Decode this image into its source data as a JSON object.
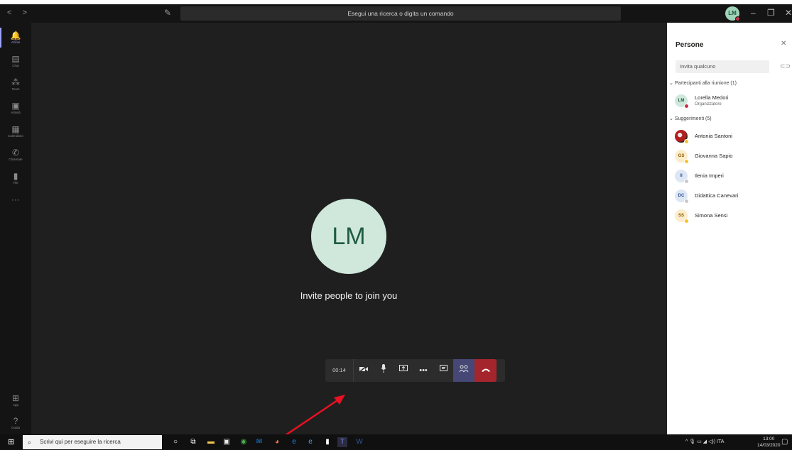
{
  "titlebar": {
    "nav_back": "<",
    "nav_forward": ">",
    "search_placeholder": "Esegui una ricerca o digita un comando",
    "user_initials": "LM",
    "minimize": "–",
    "maximize": "❐",
    "close": "✕"
  },
  "rail": {
    "items": [
      {
        "label": "Azioni",
        "icon": "bell-icon",
        "glyph": "🔔"
      },
      {
        "label": "Chat",
        "icon": "chat-icon",
        "glyph": "▤"
      },
      {
        "label": "Team",
        "icon": "team-icon",
        "glyph": "⁂"
      },
      {
        "label": "Attività",
        "icon": "assignments-icon",
        "glyph": "▣"
      },
      {
        "label": "Calendario",
        "icon": "calendar-icon",
        "glyph": "▦"
      },
      {
        "label": "Chiamate",
        "icon": "phone-icon",
        "glyph": "✆"
      },
      {
        "label": "File",
        "icon": "file-icon",
        "glyph": "▮"
      }
    ],
    "more": "···",
    "apps_label": "App",
    "help_label": "Guida"
  },
  "meeting": {
    "avatar_initials": "LM",
    "invite_text": "Invite people to join you",
    "timer": "00:14"
  },
  "panel": {
    "title": "Persone",
    "invite_placeholder": "Invita qualcuno",
    "participants_header": "Partecipanti alla riunione (1)",
    "participants": [
      {
        "initials": "LM",
        "name": "Lorella Medori",
        "role": "Organizzatore",
        "status_color": "#c4314b",
        "bg": "#d0e8dc",
        "fg": "#1f5c40"
      }
    ],
    "suggestions_header": "Suggerimenti (5)",
    "suggestions": [
      {
        "initials": "",
        "name": "Antonia Santoni",
        "status_color": "#f8c12c",
        "bg": "#5b3a2e",
        "fg": "#fff"
      },
      {
        "initials": "GS",
        "name": "Giovanna Sapio",
        "status_color": "#f8c12c",
        "bg": "#fbeccb",
        "fg": "#8a5a00"
      },
      {
        "initials": "II",
        "name": "Ilenia Imperi",
        "status_color": "#c8c8c8",
        "bg": "#dce6f5",
        "fg": "#2f4f8f"
      },
      {
        "initials": "DC",
        "name": "Didattica Canevari",
        "status_color": "#c8c8c8",
        "bg": "#dce6f5",
        "fg": "#2f4f8f"
      },
      {
        "initials": "SS",
        "name": "Simona Sensi",
        "status_color": "#f8c12c",
        "bg": "#fbeccb",
        "fg": "#8a5a00"
      }
    ]
  },
  "taskbar": {
    "search_placeholder": "Scrivi qui per eseguire la ricerca",
    "language": "ITA",
    "time": "13:00",
    "date": "14/03/2020"
  },
  "colors": {
    "accent": "#9ea2ff",
    "hangup": "#a4262c",
    "people_active": "#464775",
    "annotation_arrow": "#e81123"
  }
}
